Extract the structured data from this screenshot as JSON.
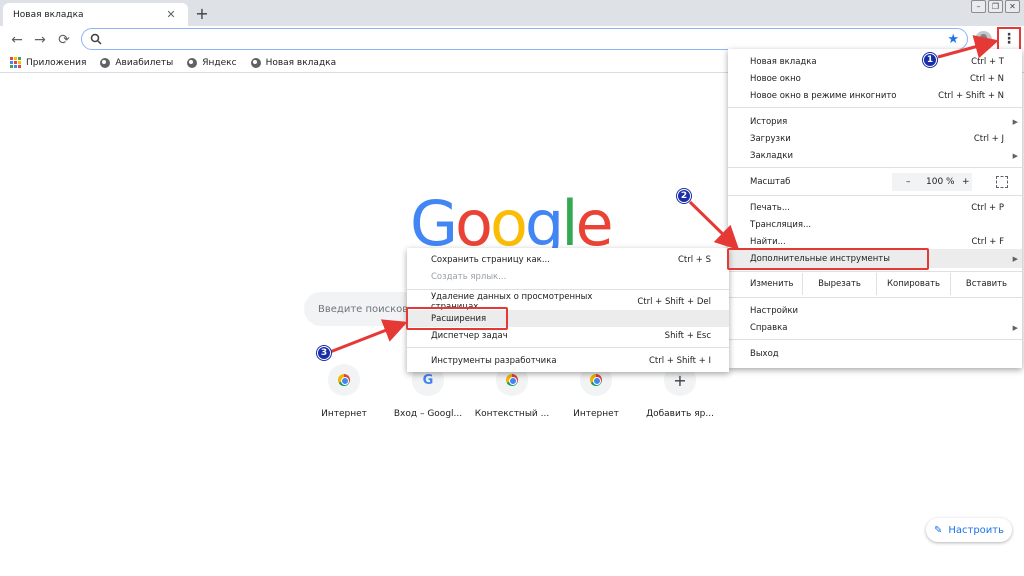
{
  "tab": {
    "title": "Новая вкладка",
    "close": "✕"
  },
  "new_tab": "+",
  "window_controls": [
    "–",
    "❐",
    "✕"
  ],
  "nav": {
    "back": "←",
    "forward": "→",
    "reload": "⟳"
  },
  "bookmarks": [
    {
      "label": "Приложения",
      "icon": "apps-icon"
    },
    {
      "label": "Авиабилеты",
      "icon": "globe-icon"
    },
    {
      "label": "Яндекс",
      "icon": "globe-icon"
    },
    {
      "label": "Новая вкладка",
      "icon": "globe-icon"
    }
  ],
  "google": {
    "logo_letters": [
      "G",
      "o",
      "o",
      "g",
      "l",
      "e"
    ],
    "logo_colors": [
      "#4285f4",
      "#ea4335",
      "#fbbc05",
      "#4285f4",
      "#34a853",
      "#ea4335"
    ],
    "search_placeholder": "Введите поисковый запрос или URL"
  },
  "shortcuts": [
    {
      "label": "Интернет",
      "icon": "chrome-icon"
    },
    {
      "label": "Вход – Googl...",
      "icon": "google-icon"
    },
    {
      "label": "Контекстный ...",
      "icon": "chrome-icon"
    },
    {
      "label": "Интернет",
      "icon": "chrome-icon"
    },
    {
      "label": "Добавить яр...",
      "icon": "plus-icon",
      "glyph": "+"
    }
  ],
  "customize": {
    "label": "Настроить",
    "icon": "pencil-icon"
  },
  "main_menu": {
    "new_tab": {
      "label": "Новая вкладка",
      "shortcut": "Ctrl + T"
    },
    "new_window": {
      "label": "Новое окно",
      "shortcut": "Ctrl + N"
    },
    "incognito": {
      "label": "Новое окно в режиме инкогнито",
      "shortcut": "Ctrl + Shift + N"
    },
    "history": {
      "label": "История"
    },
    "downloads": {
      "label": "Загрузки",
      "shortcut": "Ctrl + J"
    },
    "bookmarks": {
      "label": "Закладки"
    },
    "zoom": {
      "label": "Масштаб",
      "minus": "–",
      "value": "100 %",
      "plus": "+"
    },
    "print": {
      "label": "Печать...",
      "shortcut": "Ctrl + P"
    },
    "cast": {
      "label": "Трансляция..."
    },
    "find": {
      "label": "Найти...",
      "shortcut": "Ctrl + F"
    },
    "more_tools": {
      "label": "Дополнительные инструменты"
    },
    "edit": {
      "label": "Изменить",
      "cut": "Вырезать",
      "copy": "Копировать",
      "paste": "Вставить"
    },
    "settings": {
      "label": "Настройки"
    },
    "help": {
      "label": "Справка"
    },
    "exit": {
      "label": "Выход"
    }
  },
  "sub_menu": {
    "save_page": {
      "label": "Сохранить страницу как...",
      "shortcut": "Ctrl + S"
    },
    "create_shortcut": {
      "label": "Создать ярлык..."
    },
    "clear_data": {
      "label": "Удаление данных о просмотренных страницах...",
      "shortcut": "Ctrl + Shift + Del"
    },
    "extensions": {
      "label": "Расширения"
    },
    "task_manager": {
      "label": "Диспетчер задач",
      "shortcut": "Shift + Esc"
    },
    "dev_tools": {
      "label": "Инструменты разработчика",
      "shortcut": "Ctrl + Shift + I"
    }
  },
  "badges": [
    "1",
    "2",
    "3"
  ],
  "colors": {
    "accent": "#1a73e8",
    "annotation_red": "#e53935",
    "badge_blue": "#1a2ea8"
  }
}
